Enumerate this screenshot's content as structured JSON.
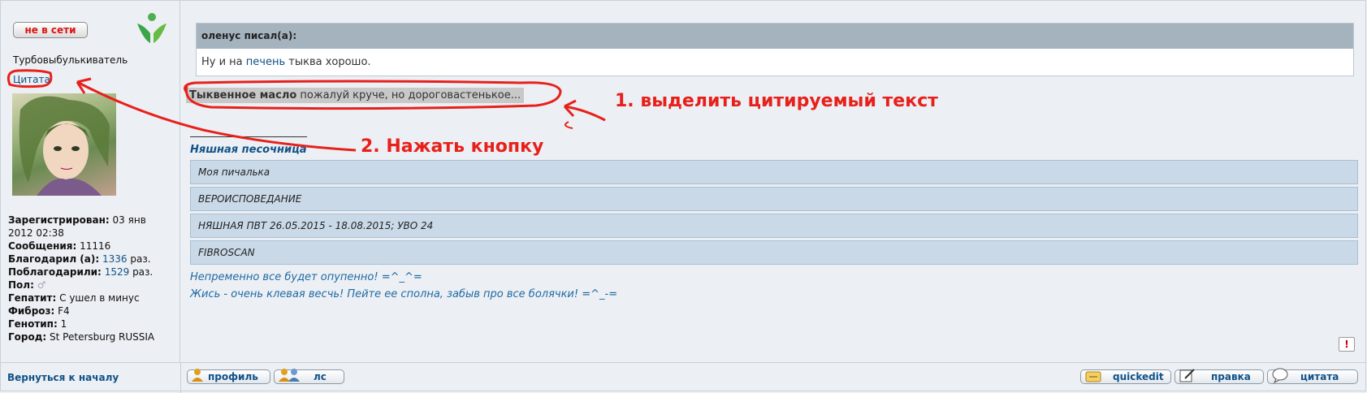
{
  "author": {
    "status_label": "не в сети",
    "user_title": "Турбовыбулькиватель",
    "quote_link": "Цитата",
    "profile": [
      {
        "label": "Зарегистрирован:",
        "value": "03 янв"
      },
      {
        "label": "",
        "value": "2012 02:38"
      },
      {
        "label": "Сообщения:",
        "value": "11116"
      },
      {
        "label": "Благодарил (а):",
        "value": "1336",
        "suffix": "раз."
      },
      {
        "label": "Поблагодарили:",
        "value": "1529",
        "suffix": "раз."
      },
      {
        "label": "Пол:",
        "value": "♂"
      },
      {
        "label": "Гепатит:",
        "value": "С ушел в минус"
      },
      {
        "label": "Фиброз:",
        "value": "F4"
      },
      {
        "label": "Генотип:",
        "value": "1"
      },
      {
        "label": "Город:",
        "value": "St Petersburg RUSSIA"
      }
    ]
  },
  "post": {
    "quote_header": "оленус писал(а):",
    "quote_text_before": "Ну и на ",
    "quote_text_link": "печень",
    "quote_text_after": " тыква хорошо.",
    "selected_bold": "Тыквенное масло",
    "selected_rest": " пожалуй круче, но дороговастенькое..."
  },
  "signature": {
    "title": "Няшная песочница",
    "rows": [
      "Моя пичалька",
      "ВЕРОИСПОВЕДАНИЕ",
      "НЯШНАЯ ПВТ 26.05.2015 - 18.08.2015; УВО 24",
      "FIBROSCAN"
    ],
    "line1": "Непременно все будет опупенно! =^_^=",
    "line2": "Жись - очень клевая весчь! Пейте ее сполна, забыв про все болячки! =^_-="
  },
  "report_label": "!",
  "footer": {
    "back_to_top": "Вернуться к началу",
    "profile_btn": "профиль",
    "pm_btn": "лс",
    "quickedit_btn": "quickedit",
    "edit_btn": "правка",
    "quote_btn": "цитата"
  },
  "annotations": {
    "step1": "1. выделить цитируемый текст",
    "step2": "2. Нажать кнопку"
  },
  "colors": {
    "annotation": "#e8201b",
    "link": "#105289",
    "quote_header": "#a5b3bf",
    "signature_box": "#c9d9e8"
  }
}
